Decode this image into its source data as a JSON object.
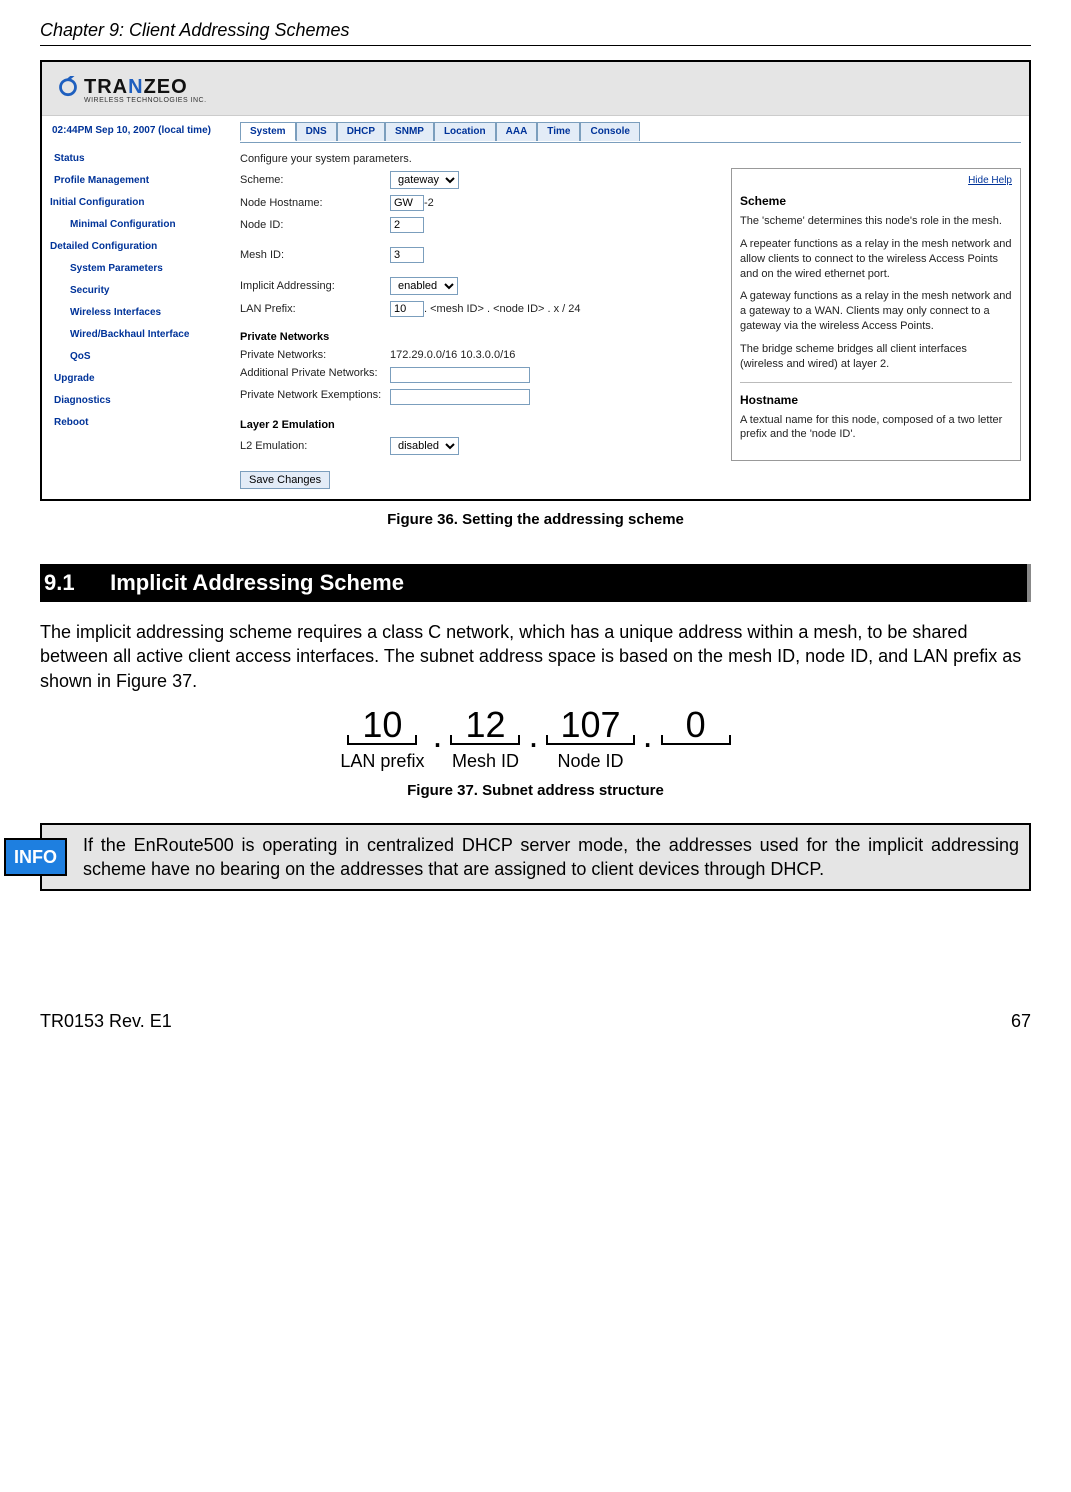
{
  "header": {
    "chapter_title": "Chapter 9: Client Addressing Schemes"
  },
  "screenshot": {
    "logo": {
      "brand_pre": "TRA",
      "brand_z": "N",
      "brand_post": "ZEO",
      "sub": "WIRELESS TECHNOLOGIES INC."
    },
    "sidebar": {
      "date": "02:44PM Sep 10, 2007 (local time)",
      "items": [
        "Status",
        "Profile Management"
      ],
      "heading1": "Initial Configuration",
      "sub1": [
        "Minimal Configuration"
      ],
      "heading2": "Detailed Configuration",
      "sub2": [
        "System Parameters",
        "Security",
        "Wireless Interfaces",
        "Wired/Backhaul Interface",
        "QoS"
      ],
      "tail": [
        "Upgrade",
        "Diagnostics",
        "Reboot"
      ]
    },
    "tabs": [
      "System",
      "DNS",
      "DHCP",
      "SNMP",
      "Location",
      "AAA",
      "Time",
      "Console"
    ],
    "intro": "Configure your system parameters.",
    "form": {
      "scheme_label": "Scheme:",
      "scheme_value": "gateway",
      "hostname_label": "Node Hostname:",
      "hostname_value": "GW",
      "hostname_suffix": "-2",
      "nodeid_label": "Node ID:",
      "nodeid_value": "2",
      "meshid_label": "Mesh ID:",
      "meshid_value": "3",
      "implicit_label": "Implicit Addressing:",
      "implicit_value": "enabled",
      "lanprefix_label": "LAN Prefix:",
      "lanprefix_value": "10",
      "lanprefix_suffix": " . <mesh ID> . <node ID> . x / 24",
      "pn_heading": "Private Networks",
      "pn_label": "Private Networks:",
      "pn_value": "172.29.0.0/16 10.3.0.0/16",
      "apn_label": "Additional Private Networks:",
      "pne_label": "Private Network Exemptions:",
      "l2_heading": "Layer 2 Emulation",
      "l2_label": "L2 Emulation:",
      "l2_value": "disabled",
      "save_label": "Save Changes"
    },
    "help": {
      "hide": "Hide Help",
      "h1": "Scheme",
      "p1": "The 'scheme' determines this node's role in the mesh.",
      "p2": "A repeater functions as a relay in the mesh network and allow clients to connect to the wireless Access Points and on the wired ethernet port.",
      "p3": "A gateway functions as a relay in the mesh network and a gateway to a WAN. Clients may only connect to a gateway via the wireless Access Points.",
      "p4": "The bridge scheme bridges all client interfaces (wireless and wired) at layer 2.",
      "h2": "Hostname",
      "p5": "A textual name for this node, composed of a two letter prefix and the 'node ID'."
    }
  },
  "figure36_caption": "Figure 36. Setting the addressing scheme",
  "section": {
    "num": "9.1",
    "title": "Implicit Addressing Scheme"
  },
  "body_para": "The implicit addressing scheme requires a class C network, which has a unique address within a mesh, to be shared between all active client access interfaces. The subnet address space is based on the mesh ID, node ID, and LAN prefix as shown in Figure 37.",
  "subnet": {
    "octets": [
      "10",
      "12",
      "107",
      "0"
    ],
    "labels": [
      "LAN prefix",
      "Mesh ID",
      "Node ID",
      ""
    ]
  },
  "figure37_caption": "Figure 37. Subnet address structure",
  "info": {
    "badge": "INFO",
    "text": "If the EnRoute500 is operating in centralized DHCP server mode, the addresses used for the implicit addressing scheme have no bearing on the addresses that are assigned to client devices through DHCP."
  },
  "footer": {
    "left": "TR0153 Rev. E1",
    "right": "67"
  }
}
